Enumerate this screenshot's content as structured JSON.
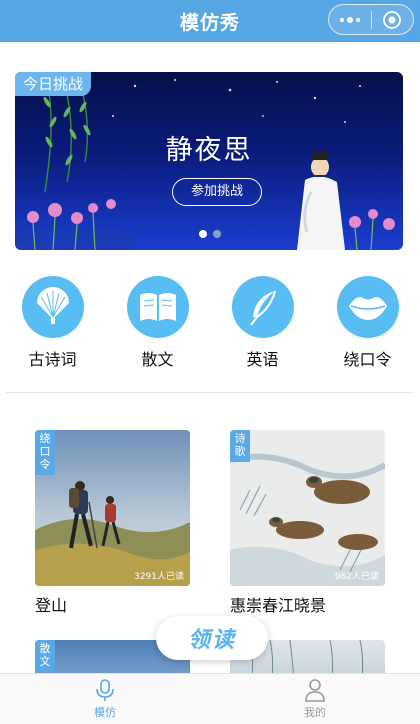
{
  "navbar": {
    "title": "模仿秀"
  },
  "banner": {
    "tag": "今日挑战",
    "title": "静夜思",
    "button_label": "参加挑战",
    "slide_count": 2,
    "active_slide": 1
  },
  "categories": [
    {
      "label": "古诗词",
      "icon": "fan-icon"
    },
    {
      "label": "散文",
      "icon": "book-icon"
    },
    {
      "label": "英语",
      "icon": "feather-icon"
    },
    {
      "label": "绕口令",
      "icon": "lips-icon"
    }
  ],
  "cards": [
    {
      "tag": "绕口令",
      "title": "登山",
      "readers": "3291人已读"
    },
    {
      "tag": "诗歌",
      "title": "惠崇春江晓景",
      "readers": "982人已读"
    },
    {
      "tag": "散文",
      "title": "",
      "readers": ""
    },
    {
      "tag": "",
      "title": "",
      "readers": ""
    }
  ],
  "floating_button": {
    "label": "领读"
  },
  "tabbar": {
    "items": [
      {
        "label": "模仿",
        "icon": "microphone-icon",
        "active": true
      },
      {
        "label": "我的",
        "icon": "user-icon",
        "active": false
      }
    ]
  },
  "colors": {
    "primary": "#58a7e5",
    "category_circle": "#58bdf3",
    "tab_active": "#58a7e5",
    "tab_inactive": "#999999"
  }
}
